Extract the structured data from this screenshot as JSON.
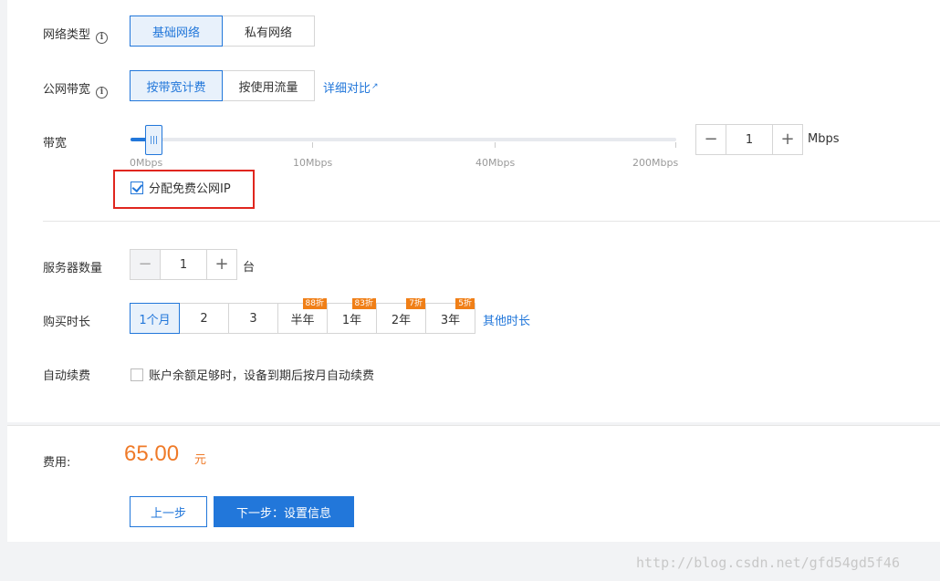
{
  "network_type": {
    "label": "网络类型",
    "options": [
      "基础网络",
      "私有网络"
    ],
    "selected": 0
  },
  "bandwidth_billing": {
    "label": "公网带宽",
    "options": [
      "按带宽计费",
      "按使用流量"
    ],
    "selected": 0,
    "compare_link": "详细对比"
  },
  "bandwidth": {
    "label": "带宽",
    "tick_labels": [
      "0Mbps",
      "10Mbps",
      "40Mbps",
      "200Mbps"
    ],
    "value": "1",
    "unit": "Mbps",
    "minus": "−",
    "plus": "+",
    "free_ip_label": "分配免费公网IP",
    "free_ip_checked": true
  },
  "server_count": {
    "label": "服务器数量",
    "value": "1",
    "unit": "台",
    "minus": "−",
    "plus": "+"
  },
  "duration": {
    "label": "购买时长",
    "options": [
      {
        "label": "1个月",
        "badge": ""
      },
      {
        "label": "2",
        "badge": ""
      },
      {
        "label": "3",
        "badge": ""
      },
      {
        "label": "半年",
        "badge": "88折"
      },
      {
        "label": "1年",
        "badge": "83折"
      },
      {
        "label": "2年",
        "badge": "7折"
      },
      {
        "label": "3年",
        "badge": "5折"
      }
    ],
    "selected": 0,
    "other_link": "其他时长"
  },
  "auto_renew": {
    "label": "自动续费",
    "text": "账户余额足够时，设备到期后按月自动续费",
    "checked": false
  },
  "cost": {
    "label": "费用:",
    "amount": "65.00",
    "unit": "元"
  },
  "buttons": {
    "prev": "上一步",
    "next": "下一步：设置信息"
  },
  "watermark": "http://blog.csdn.net/gfd54gd5f46",
  "colors": {
    "accent": "#2277da",
    "price": "#ef7a28",
    "badge": "#f07f17",
    "highlight_box": "#e0261e"
  }
}
